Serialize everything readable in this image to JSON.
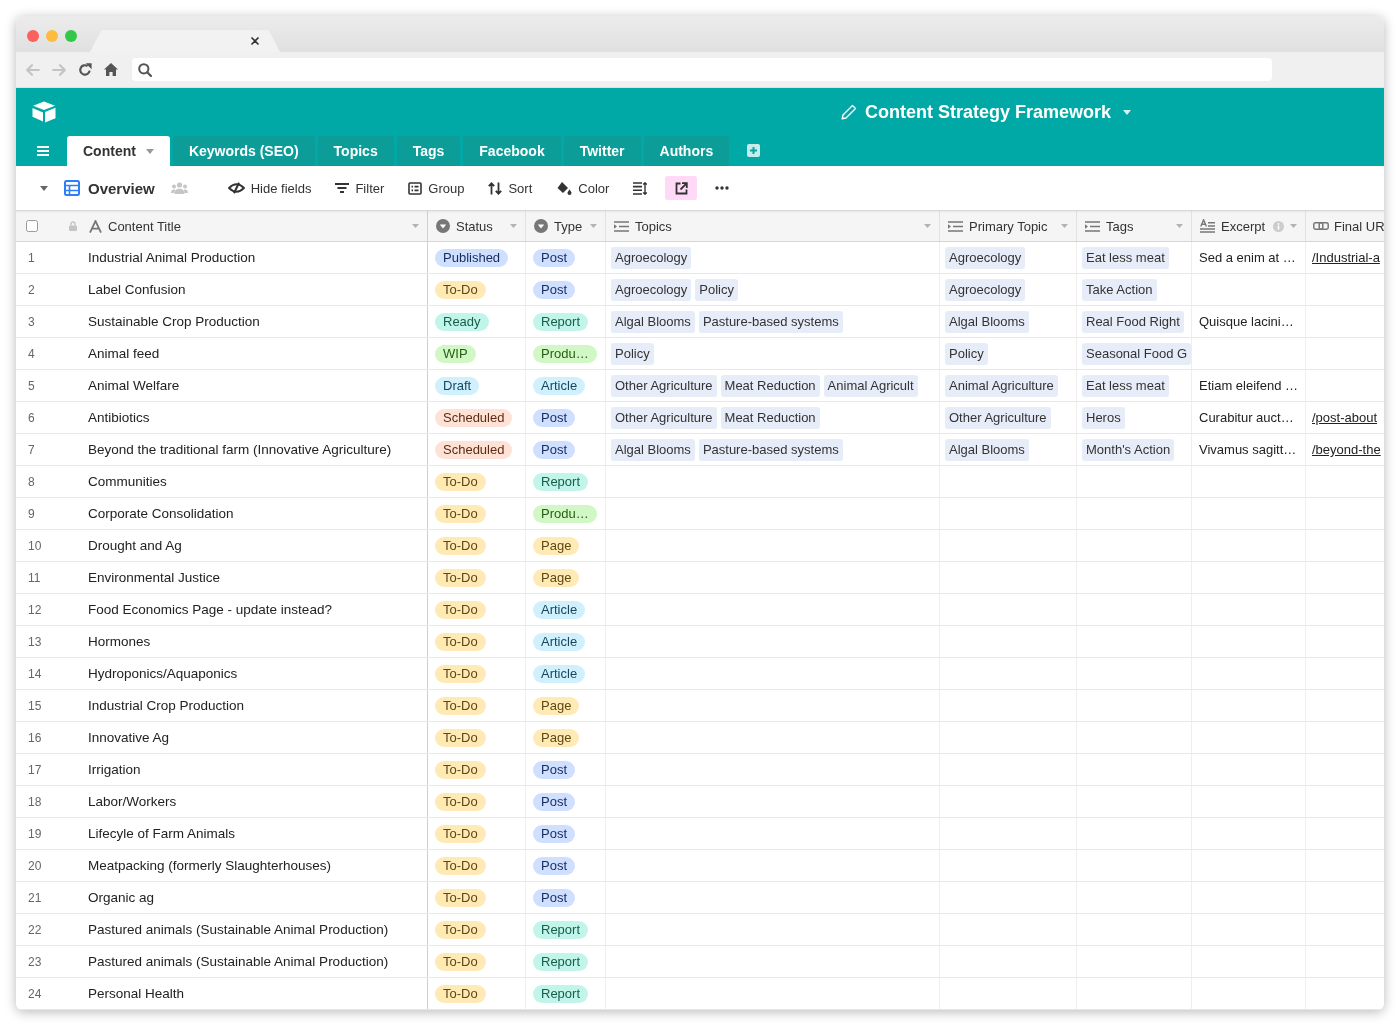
{
  "app": {
    "title": "Content Strategy Framework"
  },
  "tabs": [
    {
      "label": "Content",
      "selected": true
    },
    {
      "label": "Keywords (SEO)",
      "selected": false
    },
    {
      "label": "Topics",
      "selected": false
    },
    {
      "label": "Tags",
      "selected": false
    },
    {
      "label": "Facebook",
      "selected": false
    },
    {
      "label": "Twitter",
      "selected": false
    },
    {
      "label": "Authors",
      "selected": false
    }
  ],
  "toolbar": {
    "view": "Overview",
    "buttons": [
      {
        "kind": "hide",
        "label": "Hide fields"
      },
      {
        "kind": "filter",
        "label": "Filter"
      },
      {
        "kind": "group",
        "label": "Group"
      },
      {
        "kind": "sort",
        "label": "Sort"
      },
      {
        "kind": "color",
        "label": "Color"
      },
      {
        "kind": "row_height"
      },
      {
        "kind": "share"
      },
      {
        "kind": "more"
      }
    ]
  },
  "table": {
    "select_all": {
      "checked": false
    },
    "columns": [
      {
        "label": "Content Title",
        "kind": "text",
        "info": false
      },
      {
        "label": "Status",
        "kind": "select",
        "info": false
      },
      {
        "label": "Type",
        "kind": "select",
        "info": false
      },
      {
        "label": "Topics",
        "kind": "link",
        "info": false
      },
      {
        "label": "Primary Topic",
        "kind": "link",
        "info": false
      },
      {
        "label": "Tags",
        "kind": "link",
        "info": false
      },
      {
        "label": "Excerpt",
        "kind": "long_text",
        "info": true
      },
      {
        "label": "Final UR",
        "kind": "url",
        "info": false
      }
    ],
    "rows": [
      {
        "number": "1",
        "title": "Industrial Animal Production",
        "status": {
          "label": "Published",
          "color": "#cfdfff"
        },
        "type": {
          "label": "Post",
          "color": "#cfdfff"
        },
        "topics": [
          "Agroecology"
        ],
        "primary_topic": [
          "Agroecology"
        ],
        "tags": [
          "Eat less meat"
        ],
        "excerpt": "Sed a enim at …",
        "final_url": "/Industrial-a"
      },
      {
        "number": "2",
        "title": "Label Confusion",
        "status": {
          "label": "To-Do",
          "color": "#ffeab6"
        },
        "type": {
          "label": "Post",
          "color": "#cfdfff"
        },
        "topics": [
          "Agroecology",
          "Policy"
        ],
        "primary_topic": [
          "Agroecology"
        ],
        "tags": [
          "Take Action"
        ]
      },
      {
        "number": "3",
        "title": "Sustainable Crop Production",
        "status": {
          "label": "Ready",
          "color": "#c2f5e9"
        },
        "type": {
          "label": "Report",
          "color": "#c2f5e9"
        },
        "topics": [
          "Algal Blooms",
          "Pasture-based systems"
        ],
        "primary_topic": [
          "Algal Blooms"
        ],
        "tags": [
          "Real Food Right"
        ],
        "excerpt": "Quisque lacini…"
      },
      {
        "number": "4",
        "title": "Animal feed",
        "status": {
          "label": "WIP",
          "color": "#d1f7c4"
        },
        "type": {
          "label": "Produ…",
          "color": "#d1f7c4"
        },
        "topics": [
          "Policy"
        ],
        "primary_topic": [
          "Policy"
        ],
        "tags": [
          "Seasonal Food G"
        ]
      },
      {
        "number": "5",
        "title": "Animal Welfare",
        "status": {
          "label": "Draft",
          "color": "#d0f0fd"
        },
        "type": {
          "label": "Article",
          "color": "#d0f0fd"
        },
        "topics": [
          "Other Agriculture",
          "Meat Reduction",
          "Animal Agricult"
        ],
        "primary_topic": [
          "Animal Agriculture"
        ],
        "tags": [
          "Eat less meat"
        ],
        "excerpt": "Etiam eleifend …"
      },
      {
        "number": "6",
        "title": "Antibiotics",
        "status": {
          "label": "Scheduled",
          "color": "#fee2d5"
        },
        "type": {
          "label": "Post",
          "color": "#cfdfff"
        },
        "topics": [
          "Other Agriculture",
          "Meat Reduction"
        ],
        "primary_topic": [
          "Other Agriculture"
        ],
        "tags": [
          "Heros"
        ],
        "excerpt": "Curabitur auct…",
        "final_url": "/post-about"
      },
      {
        "number": "7",
        "title": "Beyond the traditional farm (Innovative Agriculture)",
        "status": {
          "label": "Scheduled",
          "color": "#fee2d5"
        },
        "type": {
          "label": "Post",
          "color": "#cfdfff"
        },
        "topics": [
          "Algal Blooms",
          "Pasture-based systems"
        ],
        "primary_topic": [
          "Algal Blooms"
        ],
        "tags": [
          "Month's Action"
        ],
        "excerpt": "Vivamus sagitt…",
        "final_url": "/beyond-the"
      },
      {
        "number": "8",
        "title": "Communities",
        "status": {
          "label": "To-Do",
          "color": "#ffeab6"
        },
        "type": {
          "label": "Report",
          "color": "#c2f5e9"
        }
      },
      {
        "number": "9",
        "title": "Corporate Consolidation",
        "status": {
          "label": "To-Do",
          "color": "#ffeab6"
        },
        "type": {
          "label": "Produ…",
          "color": "#d1f7c4"
        }
      },
      {
        "number": "10",
        "title": "Drought and Ag",
        "status": {
          "label": "To-Do",
          "color": "#ffeab6"
        },
        "type": {
          "label": "Page",
          "color": "#ffeab6"
        }
      },
      {
        "number": "11",
        "title": "Environmental Justice",
        "status": {
          "label": "To-Do",
          "color": "#ffeab6"
        },
        "type": {
          "label": "Page",
          "color": "#ffeab6"
        }
      },
      {
        "number": "12",
        "title": "Food Economics Page - update instead?",
        "status": {
          "label": "To-Do",
          "color": "#ffeab6"
        },
        "type": {
          "label": "Article",
          "color": "#d0f0fd"
        }
      },
      {
        "number": "13",
        "title": "Hormones",
        "status": {
          "label": "To-Do",
          "color": "#ffeab6"
        },
        "type": {
          "label": "Article",
          "color": "#d0f0fd"
        }
      },
      {
        "number": "14",
        "title": "Hydroponics/Aquaponics",
        "status": {
          "label": "To-Do",
          "color": "#ffeab6"
        },
        "type": {
          "label": "Article",
          "color": "#d0f0fd"
        }
      },
      {
        "number": "15",
        "title": "Industrial Crop Production",
        "status": {
          "label": "To-Do",
          "color": "#ffeab6"
        },
        "type": {
          "label": "Page",
          "color": "#ffeab6"
        }
      },
      {
        "number": "16",
        "title": "Innovative Ag",
        "status": {
          "label": "To-Do",
          "color": "#ffeab6"
        },
        "type": {
          "label": "Page",
          "color": "#ffeab6"
        }
      },
      {
        "number": "17",
        "title": "Irrigation",
        "status": {
          "label": "To-Do",
          "color": "#ffeab6"
        },
        "type": {
          "label": "Post",
          "color": "#cfdfff"
        }
      },
      {
        "number": "18",
        "title": "Labor/Workers",
        "status": {
          "label": "To-Do",
          "color": "#ffeab6"
        },
        "type": {
          "label": "Post",
          "color": "#cfdfff"
        }
      },
      {
        "number": "19",
        "title": "Lifecyle of Farm Animals",
        "status": {
          "label": "To-Do",
          "color": "#ffeab6"
        },
        "type": {
          "label": "Post",
          "color": "#cfdfff"
        }
      },
      {
        "number": "20",
        "title": "Meatpacking (formerly Slaughterhouses)",
        "status": {
          "label": "To-Do",
          "color": "#ffeab6"
        },
        "type": {
          "label": "Post",
          "color": "#cfdfff"
        }
      },
      {
        "number": "21",
        "title": "Organic ag",
        "status": {
          "label": "To-Do",
          "color": "#ffeab6"
        },
        "type": {
          "label": "Post",
          "color": "#cfdfff"
        }
      },
      {
        "number": "22",
        "title": "Pastured animals (Sustainable Animal Production)",
        "status": {
          "label": "To-Do",
          "color": "#ffeab6"
        },
        "type": {
          "label": "Report",
          "color": "#c2f5e9"
        }
      },
      {
        "number": "23",
        "title": "Pastured animals (Sustainable Animal Production)",
        "status": {
          "label": "To-Do",
          "color": "#ffeab6"
        },
        "type": {
          "label": "Report",
          "color": "#c2f5e9"
        }
      },
      {
        "number": "24",
        "title": "Personal Health",
        "status": {
          "label": "To-Do",
          "color": "#ffeab6"
        },
        "type": {
          "label": "Report",
          "color": "#c2f5e9"
        }
      }
    ]
  }
}
